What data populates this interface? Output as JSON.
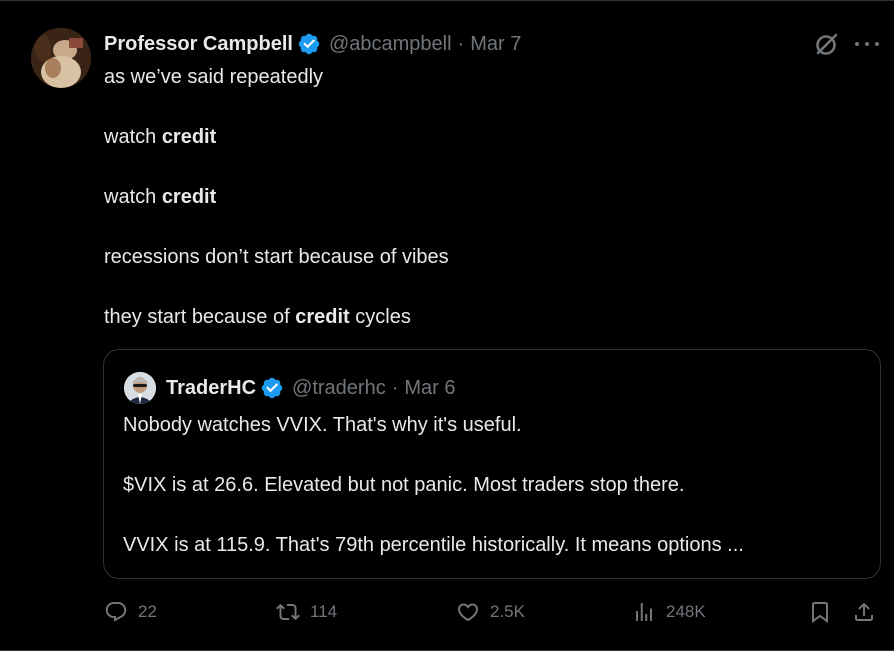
{
  "tweet": {
    "author": {
      "display_name": "Professor Campbell",
      "handle": "@abcampbell",
      "date": "Mar 7",
      "verified": true
    },
    "body": [
      {
        "parts": [
          {
            "text": "as we’ve said repeatedly",
            "bold": false
          }
        ]
      },
      {
        "parts": [
          {
            "text": "watch ",
            "bold": false
          },
          {
            "text": "credit",
            "bold": true
          }
        ]
      },
      {
        "parts": [
          {
            "text": "watch ",
            "bold": false
          },
          {
            "text": "credit",
            "bold": true
          }
        ]
      },
      {
        "parts": [
          {
            "text": "recessions don’t start because of vibes",
            "bold": false
          }
        ]
      },
      {
        "parts": [
          {
            "text": "they start because of ",
            "bold": false
          },
          {
            "text": "credit",
            "bold": true
          },
          {
            "text": " cycles",
            "bold": false
          }
        ]
      }
    ],
    "separator": "·"
  },
  "quote": {
    "author": {
      "display_name": "TraderHC",
      "handle": "@traderhc",
      "date": "Mar 6",
      "verified": true
    },
    "lines": [
      "Nobody watches VVIX. That's why it's useful.",
      "$VIX is at 26.6. Elevated but not panic. Most traders stop there.",
      "VVIX is at 115.9. That's 79th percentile historically. It means options ..."
    ]
  },
  "actions": {
    "replies": "22",
    "retweets": "114",
    "likes": "2.5K",
    "views": "248K"
  },
  "icons": {
    "verified": "verified-badge-icon",
    "grok": "grok-icon",
    "more": "more-icon",
    "reply": "reply-icon",
    "retweet": "retweet-icon",
    "like": "heart-icon",
    "views": "views-icon",
    "bookmark": "bookmark-icon",
    "share": "share-icon"
  },
  "colors": {
    "background": "#000000",
    "text": "#e7e9ea",
    "muted": "#71767b",
    "border": "#2f3336",
    "verified": "#1d9bf0"
  }
}
